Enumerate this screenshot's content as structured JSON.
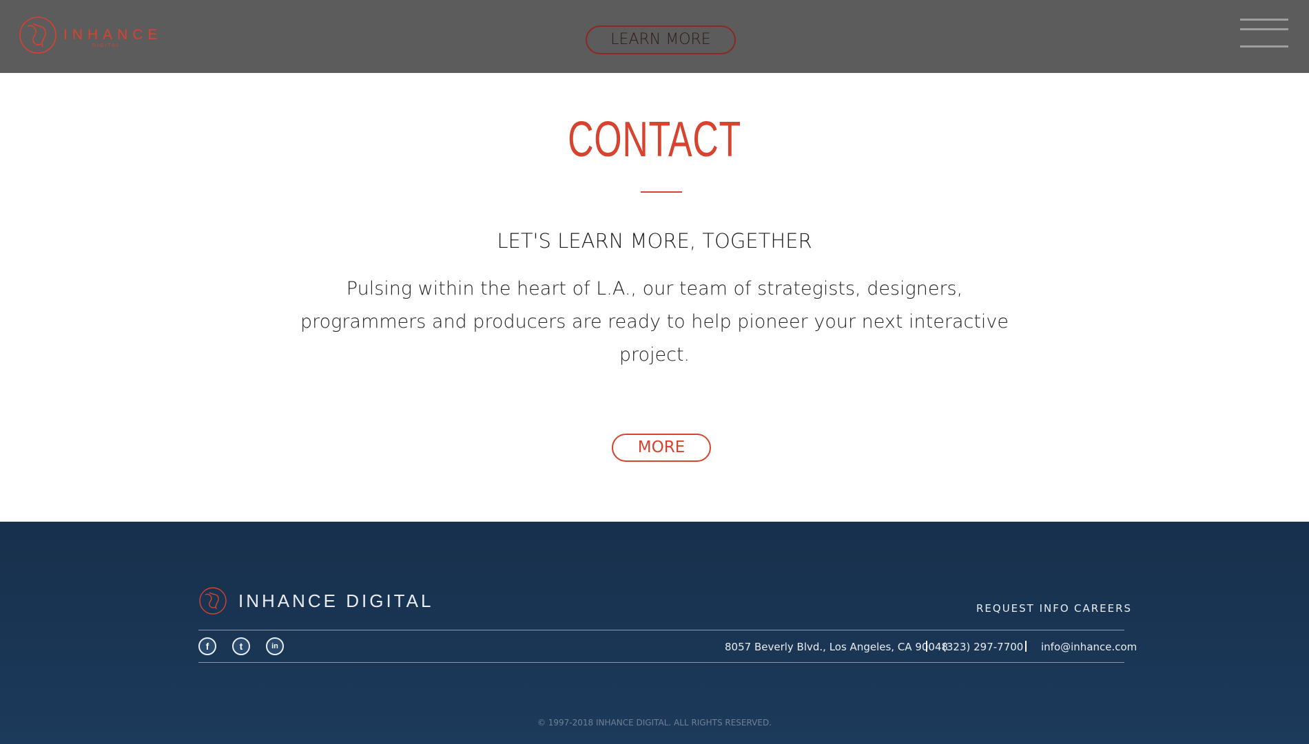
{
  "header": {
    "logo_text": "INHANCE",
    "logo_subtext": "DIGITAL",
    "learn_more_label": "LEARN MORE"
  },
  "contact": {
    "title": "CONTACT",
    "heading": "LET'S LEARN MORE, TOGETHER",
    "body": "Pulsing within the heart of L.A., our team of strategists, designers, programmers and producers are ready to help pioneer your next interactive project.",
    "more_label": "MORE"
  },
  "footer": {
    "brand": "INHANCE DIGITAL",
    "nav": [
      "REQUEST INFO",
      "CAREERS"
    ],
    "social": [
      {
        "icon": "facebook-icon",
        "glyph": "f"
      },
      {
        "icon": "twitter-icon",
        "glyph": "t"
      },
      {
        "icon": "linkedin-icon",
        "glyph": "in"
      }
    ],
    "address": "8057 Beverly Blvd., Los Angeles, CA 90048",
    "phone": "(323) 297-7700",
    "email": "info@inhance.com",
    "copyright": "© 1997-2018 INHANCE DIGITAL. ALL RIGHTS RESERVED."
  },
  "colors": {
    "accent": "#d7432e",
    "header_bg": "#5c5c5c",
    "footer_bg": "#1a3553"
  }
}
